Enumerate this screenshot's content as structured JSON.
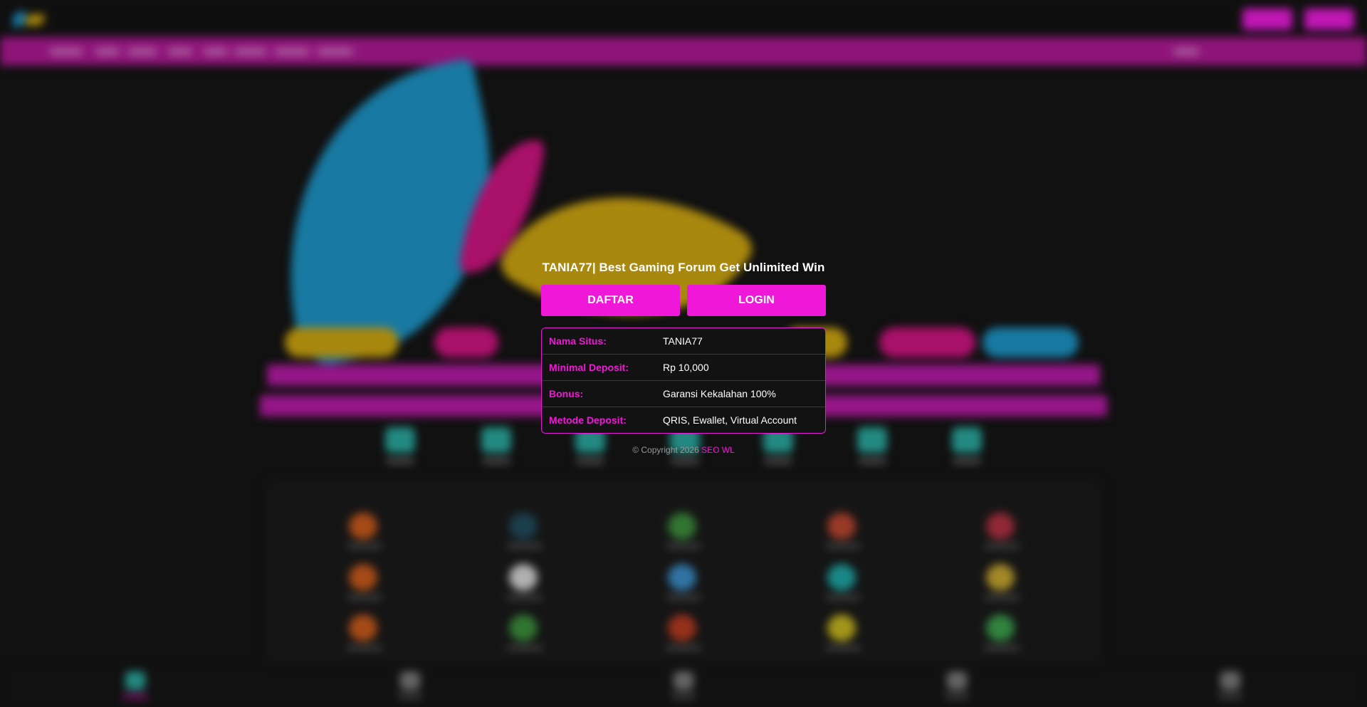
{
  "modal": {
    "title": "TANIA77| Best Gaming Forum Get Unlimited Win",
    "register_label": "DAFTAR",
    "login_label": "LOGIN",
    "info": [
      {
        "key": "Nama Situs:",
        "value": "TANIA77"
      },
      {
        "key": "Minimal Deposit:",
        "value": "Rp 10,000"
      },
      {
        "key": "Bonus:",
        "value": "Garansi Kekalahan 100%"
      },
      {
        "key": "Metode Deposit:",
        "value": "QRIS, Ewallet, Virtual Account"
      }
    ],
    "copyright_prefix": "© Copyright 2026",
    "copyright_link": "SEO WL"
  },
  "colors": {
    "accent": "#f018d8",
    "background": "#141414",
    "nav_bar": "#a8188f"
  }
}
